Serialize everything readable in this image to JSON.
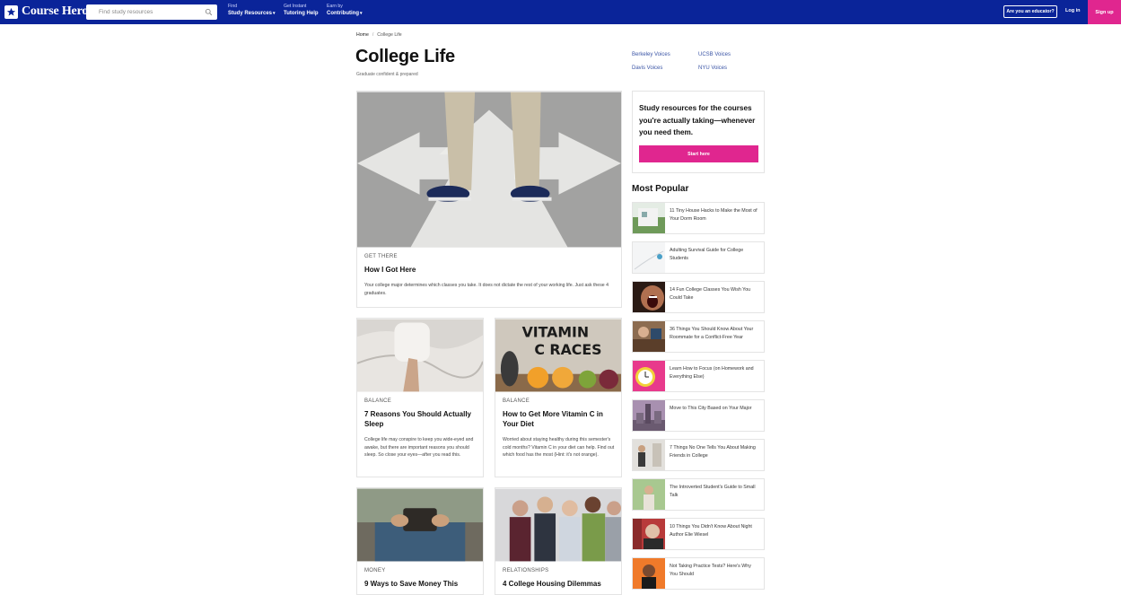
{
  "header": {
    "logo_text": "Course Hero",
    "search_placeholder": "Find study resources",
    "nav": [
      {
        "small": "Find",
        "big": "Study Resources"
      },
      {
        "small": "Get Instant",
        "big": "Tutoring Help"
      },
      {
        "small": "Earn by",
        "big": "Contributing"
      }
    ],
    "educator_label": "Are you an educator?",
    "login_label": "Log in",
    "signup_label": "Sign up"
  },
  "breadcrumb": {
    "home": "Home",
    "separator": "/",
    "current": "College Life"
  },
  "page": {
    "title": "College Life",
    "subtitle": "Graduate confident & prepared"
  },
  "voices": [
    "Berkeley Voices",
    "UCSB Voices",
    "Davis Voices",
    "NYU Voices"
  ],
  "featured": {
    "category": "GET THERE",
    "headline": "How I Got Here",
    "description": "Your college major determines which classes you take. It does not dictate the rest of your working life. Just ask these 4 graduates."
  },
  "cards": [
    {
      "category": "BALANCE",
      "headline": "7 Reasons You Should Actually Sleep",
      "description": "College life may conspire to keep you wide-eyed and awake, but there are important reasons you should sleep. So close your eyes—after you read this."
    },
    {
      "category": "BALANCE",
      "headline": "How to Get More Vitamin C in Your Diet",
      "description": "Worried about staying healthy during this semester's cold months? Vitamin C in your diet can help. Find out which food has the most (Hint: it's not orange)."
    },
    {
      "category": "MONEY",
      "headline": "9 Ways to Save Money This"
    },
    {
      "category": "RELATIONSHIPS",
      "headline": "4 College Housing Dilemmas"
    }
  ],
  "vitamin_sign": {
    "line1": "VITAMIN",
    "line2": "C RACES"
  },
  "promo": {
    "text": "Study resources for the courses you're actually taking—whenever you need them.",
    "button": "Start here"
  },
  "most_popular": {
    "title": "Most Popular",
    "items": [
      "11 Tiny House Hacks to Make the Most of Your Dorm Room",
      "Adulting Survival Guide for College Students",
      "14 Fun College Classes You Wish You Could Take",
      "36 Things You Should Know About Your Roommate for a Conflict-Free Year",
      "Learn How to Focus (on Homework and Everything Else)",
      "Move to This City Based on Your Major",
      "7 Things No One Tells You About Making Friends in College",
      "The Introverted Student's Guide to Small Talk",
      "10 Things You Didn't Know About Night Author Elie Wiesel",
      "Not Taking Practice Tests? Here's Why You Should"
    ]
  },
  "colors": {
    "brand_blue": "#0a2499",
    "accent_pink": "#e0268f",
    "link_blue": "#3b55a6"
  }
}
